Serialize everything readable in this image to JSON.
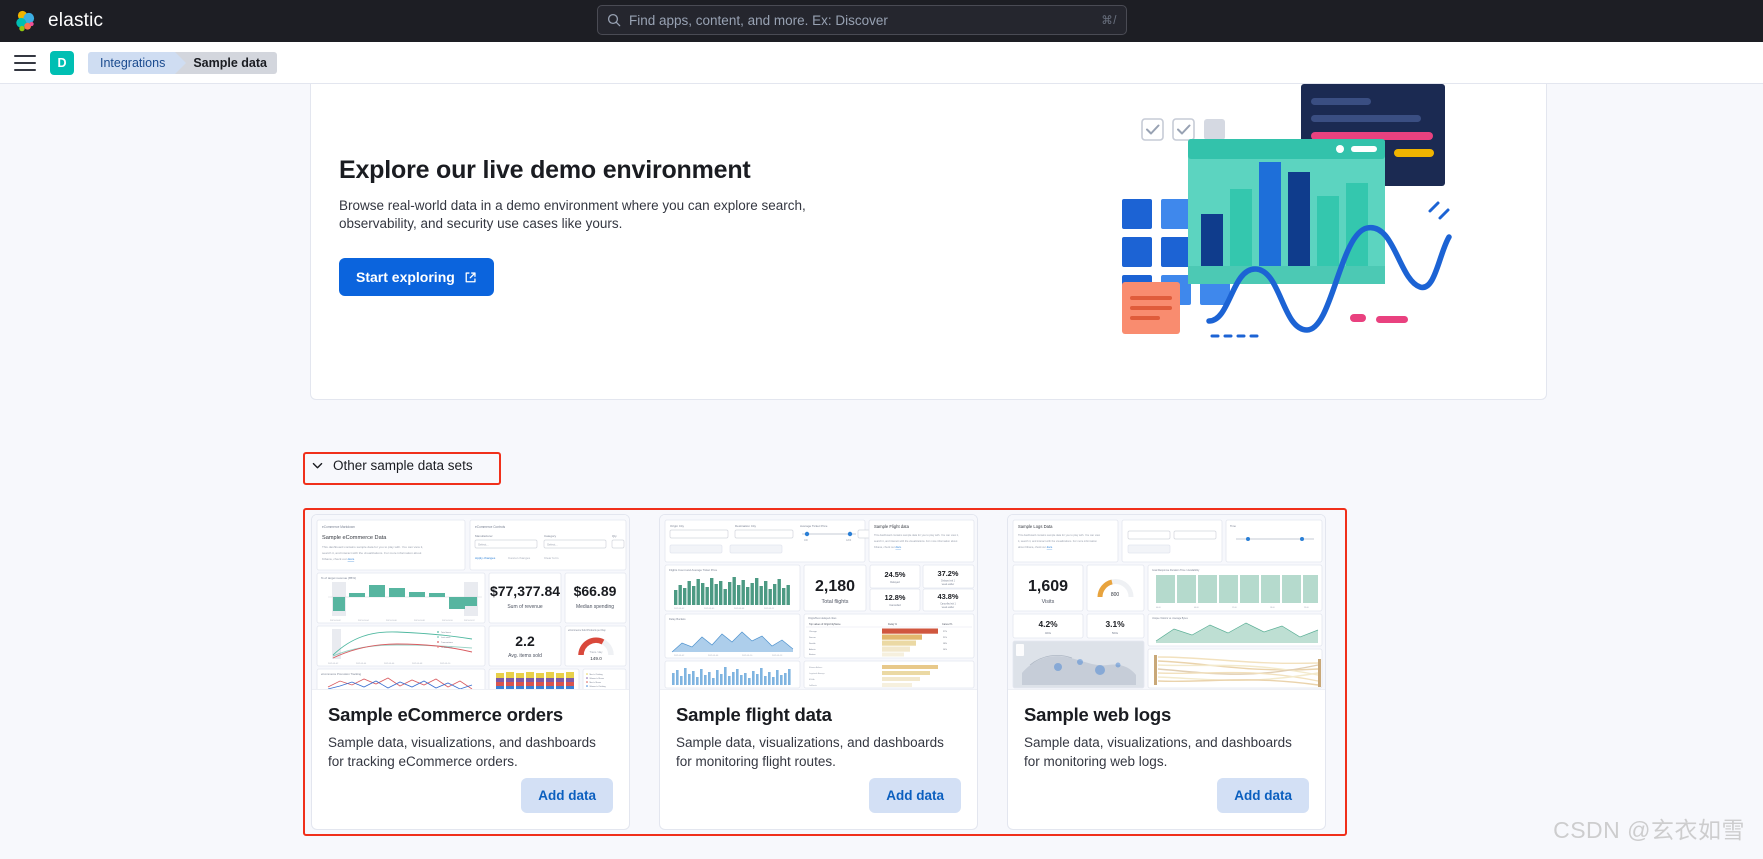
{
  "topbar": {
    "brand_name": "elastic",
    "logo_icon": "elastic-logo",
    "search": {
      "icon": "search-icon",
      "placeholder": "Find apps, content, and more. Ex: Discover",
      "shortcut": "⌘/"
    }
  },
  "navbar": {
    "menu_icon": "hamburger-menu-icon",
    "space_avatar": "D",
    "breadcrumb": [
      {
        "label": "Integrations",
        "current": false
      },
      {
        "label": "Sample data",
        "current": true
      }
    ]
  },
  "hero": {
    "title": "Explore our live demo environment",
    "description": "Browse real-world data in a demo environment where you can explore search, observability, and security use cases like yours.",
    "cta_label": "Start exploring",
    "cta_icon": "external-link-icon"
  },
  "accordion": {
    "label": "Other sample data sets",
    "icon": "chevron-down-icon",
    "expanded": true,
    "highlight_color": "#F0301B"
  },
  "cards": [
    {
      "id": "ecommerce",
      "title": "Sample eCommerce orders",
      "description": "Sample data, visualizations, and dashboards for tracking eCommerce orders.",
      "button_label": "Add data",
      "thumbnail": {
        "panel_title": "Sample eCommerce Data",
        "panel_text": "This dashboard contains sample data for you to play with. You can view it, search it, and interact with the visualizations. For more information about Kibana, check our docs.",
        "controls_title": "eCommerce Controls",
        "control_labels": [
          "Manufacturer",
          "Category",
          "Quantity"
        ],
        "control_placeholder": "Select...",
        "control_buttons": [
          "Apply changes",
          "Cancel changes",
          "Clear form"
        ],
        "metrics": [
          {
            "value": "$77,377.84",
            "label": "Sum of revenue"
          },
          {
            "value": "$66.89",
            "label": "Median spending"
          },
          {
            "value": "2.2",
            "label": "Avg. items sold"
          }
        ],
        "gauge": {
          "value": "149.0",
          "label": "Trans / day"
        },
        "chart_titles": [
          "% of target revenue (85%)",
          "eCommerce Promotion Tracking",
          "eCommerce Sold Products per Day"
        ],
        "legend_items": [
          "Total items",
          "Last week",
          "Transactions",
          "Tx last week"
        ]
      }
    },
    {
      "id": "flights",
      "title": "Sample flight data",
      "description": "Sample data, visualizations, and dashboards for monitoring flight routes.",
      "button_label": "Add data",
      "thumbnail": {
        "panel_title": "Sample Flight data",
        "panel_text": "This dashboard contains sample data for you to play with. You can view it, search it, and interact with the visualizations. For more information about Kibana, check our docs.",
        "control_labels": [
          "Origin City",
          "Destination City",
          "Average Ticket Price"
        ],
        "slider_range": [
          "100",
          "1200"
        ],
        "metrics": [
          {
            "value": "2,180",
            "label": "Total flights"
          },
          {
            "value": "24.5%",
            "label": "Delayed"
          },
          {
            "value": "37.2%",
            "label": "Delayed wk 1 week earlier"
          },
          {
            "value": "12.8%",
            "label": "Cancelled"
          },
          {
            "value": "43.8%",
            "label": "Cancelled wk 1 week earlier"
          }
        ],
        "table_title": "Origin/Dest delayed cities",
        "table_headers": [
          "Top values of OriginCityName",
          "Delay %",
          "Cancel %"
        ]
      }
    },
    {
      "id": "weblogs",
      "title": "Sample web logs",
      "description": "Sample data, visualizations, and dashboards for monitoring web logs.",
      "button_label": "Add data",
      "thumbnail": {
        "panel_title": "Sample Logs Data",
        "panel_text": "This dashboard contains sample data for you to play with. You can view it, search it, and interact with the visualizations. For more information about Kibana, check our docs.",
        "metrics": [
          {
            "value": "1,609",
            "label": "Visits"
          },
          {
            "value": "4.2%",
            "label": "400s"
          },
          {
            "value": "3.1%",
            "label": "500s"
          }
        ],
        "gauge": {
          "value": "800",
          "label": ""
        },
        "chart_titles": [
          "Goal Response Duration Time / Availability",
          "Unique Visitors vs. Average Bytes",
          "Source and Destination Sankey Chart"
        ]
      }
    }
  ],
  "watermark": "CSDN @玄衣如雪",
  "theme": {
    "dark_bar": "#1D1E24",
    "page_bg": "#F7F8FC",
    "primary_blue": "#0B64DD",
    "secondary_blue_bg": "#D3E0F5",
    "secondary_blue_text": "#0B5FBF",
    "teal": "#00BFB3",
    "annotation_red": "#F0301B"
  }
}
